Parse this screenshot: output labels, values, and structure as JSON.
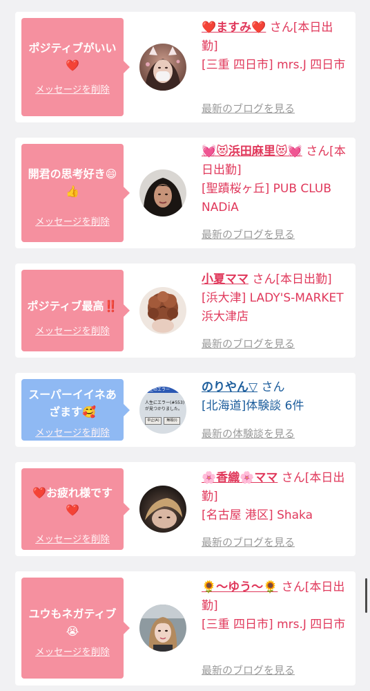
{
  "entries": [
    {
      "message_parts": [
        "ポジティブがいい",
        "❤️"
      ],
      "delete_label": "メッセージを削除",
      "name": "❤️ますみ❤️",
      "suffix": "さん[本日出勤]",
      "shop": "[三重 四日市] mrs.J 四日市",
      "link": "最新のブログを見る"
    },
    {
      "message_parts": [
        "開君の思考好き😄",
        "👍"
      ],
      "delete_label": "メッセージを削除",
      "name": "💓😻浜田麻里😻💓",
      "suffix": "さん[本日出勤]",
      "shop": "[聖蹟桜ヶ丘] PUB CLUB NADiA",
      "link": "最新のブログを見る"
    },
    {
      "message_parts": [
        "ポジティブ最高",
        "‼️"
      ],
      "delete_label": "メッセージを削除",
      "name": "小夏ママ",
      "suffix": "さん[本日出勤]",
      "shop": "[浜大津] LADY'S-MARKET 浜大津店",
      "link": "最新のブログを見る"
    },
    {
      "message_parts": [
        "スーパーイイネあざます",
        "🥰"
      ],
      "delete_label": "メッセージを削除",
      "name": "のりやん▽",
      "suffix": "さん",
      "shop": "[北海道]体験談 6件",
      "link": "最新の体験談を見る"
    },
    {
      "message_parts": [
        "❤️",
        "お疲れ様です",
        "❤️"
      ],
      "delete_label": "メッセージを削除",
      "name": "🌸香織🌸ママ",
      "suffix": "さん[本日出勤]",
      "shop": "[名古屋 港区] Shaka",
      "link": "最新のブログを見る"
    },
    {
      "message_parts": [
        "ユウもネガティブ",
        "😭"
      ],
      "delete_label": "メッセージを削除",
      "name": "🌻〜ゆう〜🌻",
      "suffix": "さん[本日出勤]",
      "shop": "[三重 四日市] mrs.J 四日市",
      "link": "最新のブログを見る"
    }
  ],
  "avatar_4_text": [
    "生のエラー",
    "人生にエラー(#553)",
    "が見つかりました。",
    "中止(A)",
    "無視(I)"
  ],
  "colors": {
    "pink_bubble": "#f5909f",
    "blue_bubble": "#8fb9f3",
    "name_pink": "#e0385b",
    "name_blue": "#1c5d9c",
    "link_gray": "#9a9a9a",
    "background": "#f1f1f3"
  }
}
